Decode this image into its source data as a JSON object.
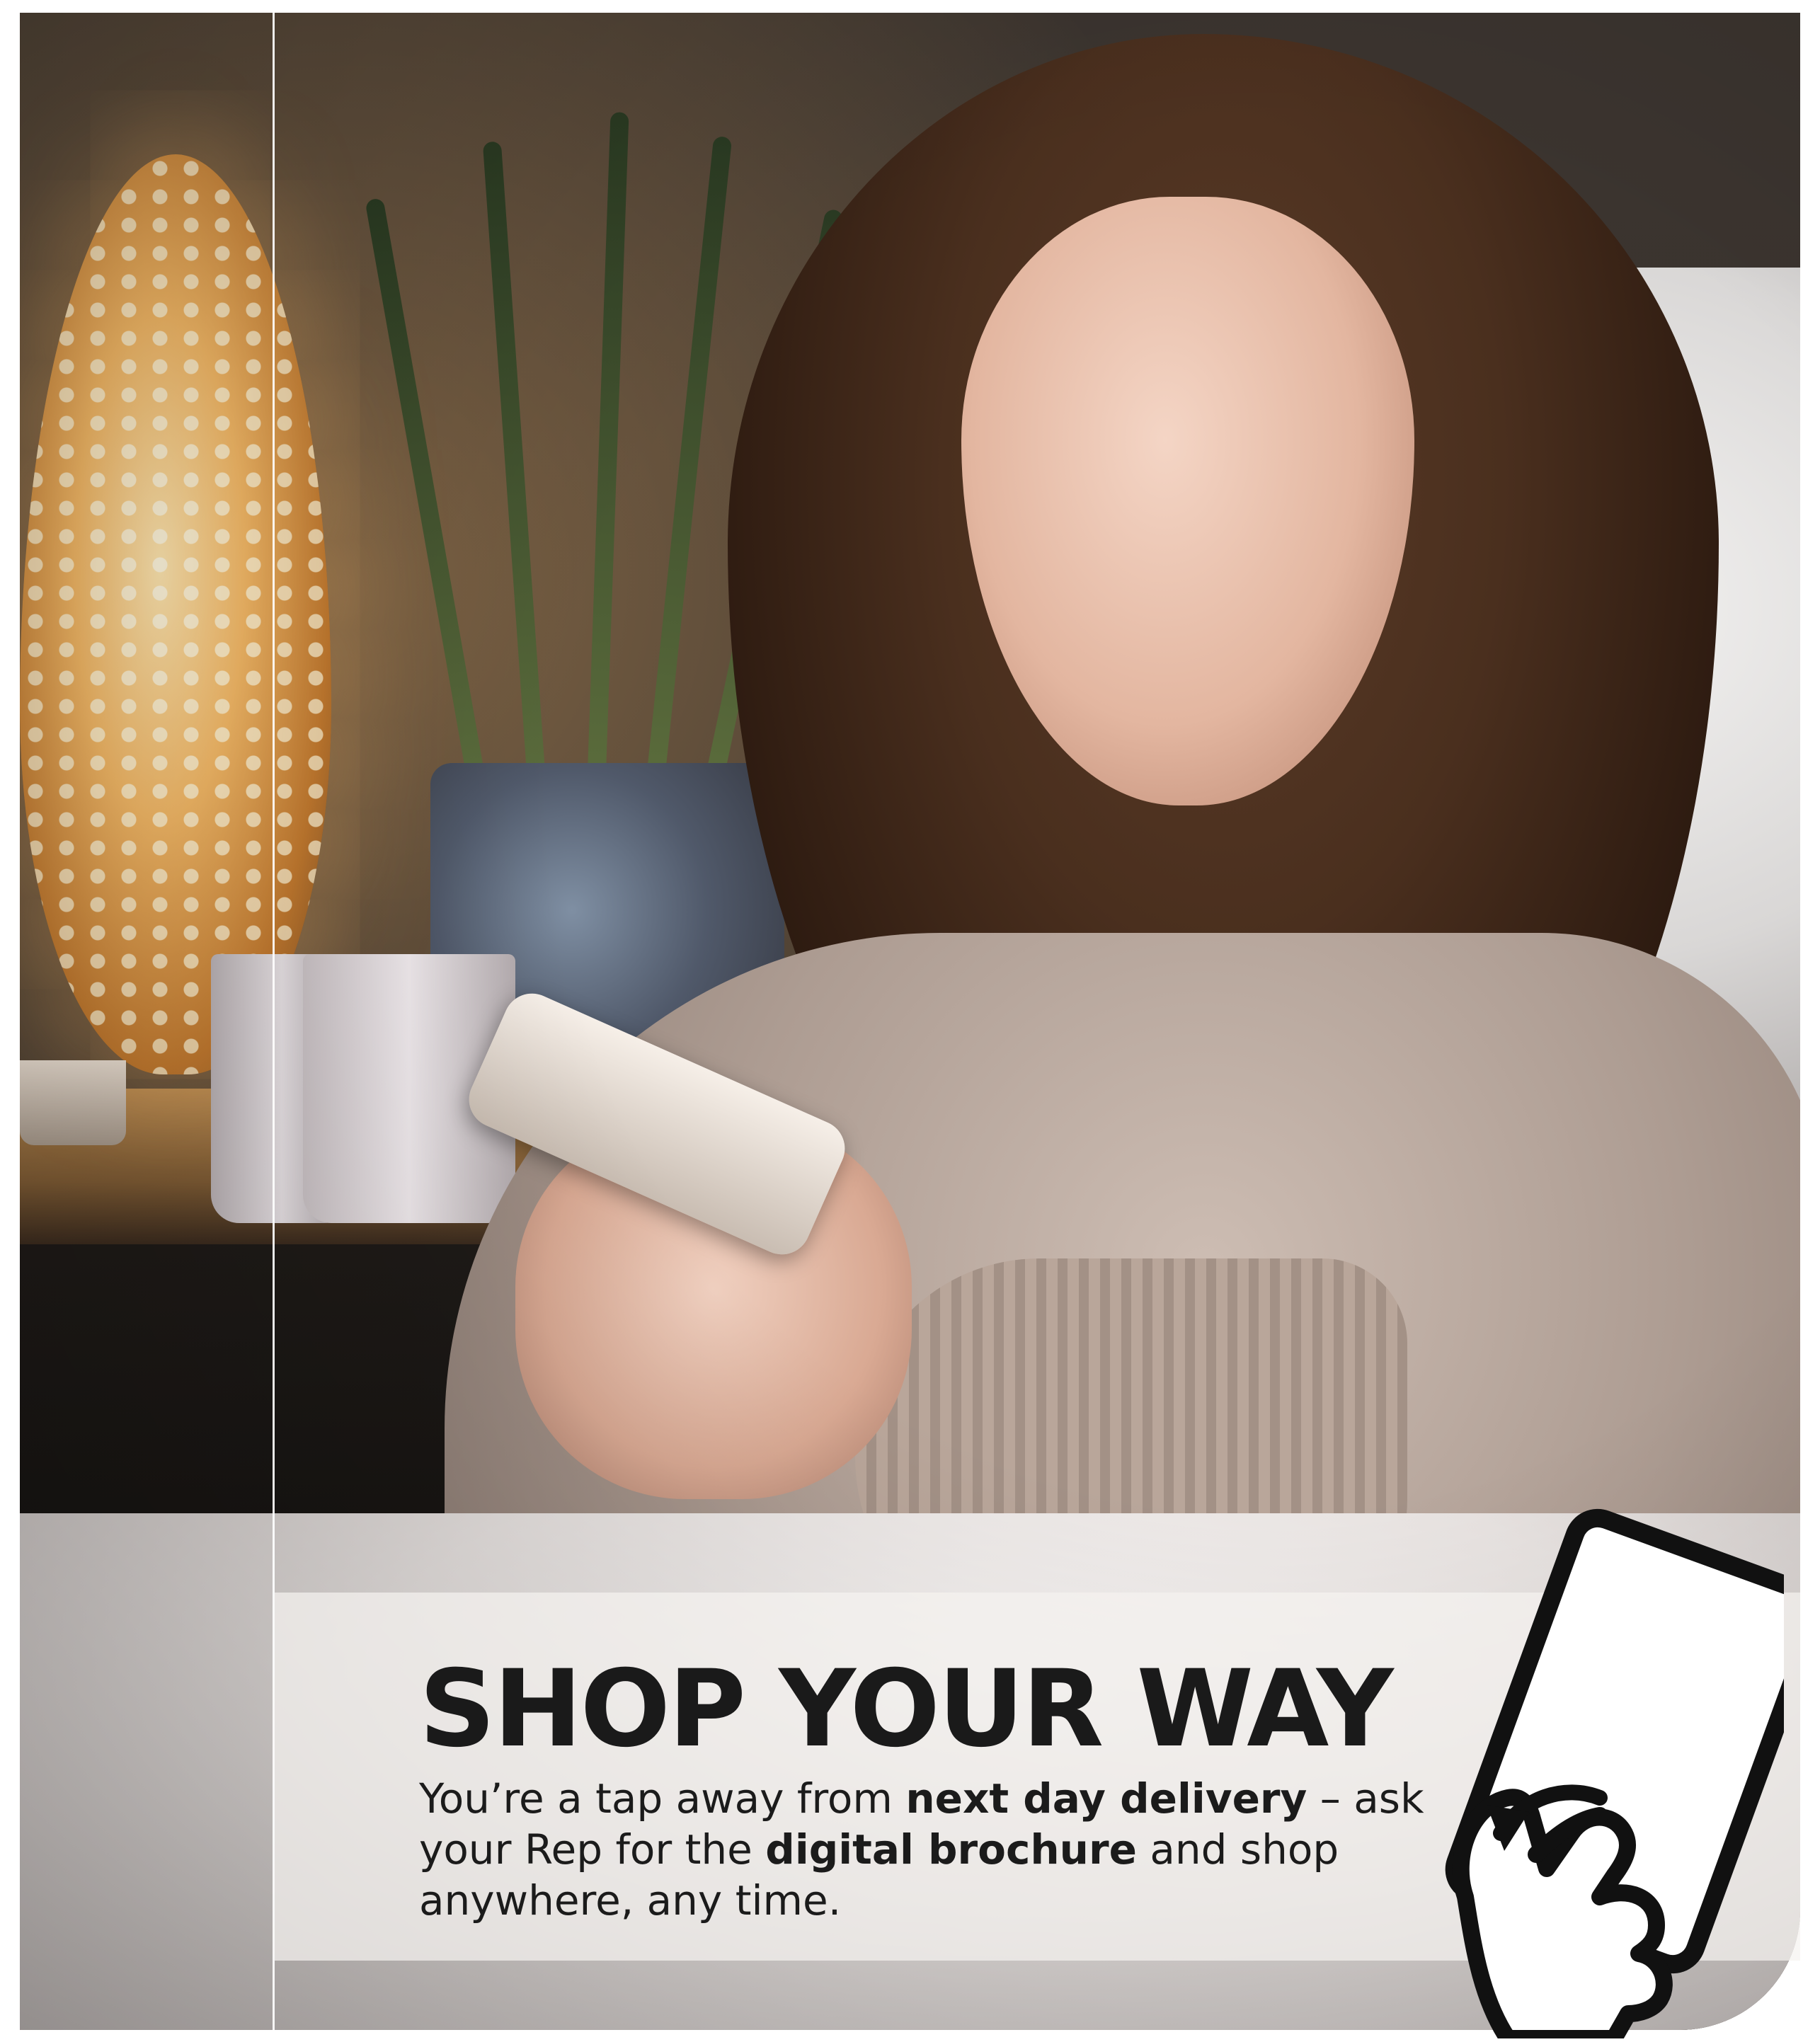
{
  "promo": {
    "headline": "SHOP YOUR WAY",
    "body": {
      "part1": "You’re a tap away from ",
      "bold1": "next day delivery",
      "part2": " – ask your Rep for the ",
      "bold2": "digital brochure",
      "part3": " and shop anywhere, any time."
    }
  },
  "icons": {
    "tap": "phone-tap-icon"
  },
  "colors": {
    "headline": "#1a1a1a",
    "panel": "#f5f2f0"
  }
}
